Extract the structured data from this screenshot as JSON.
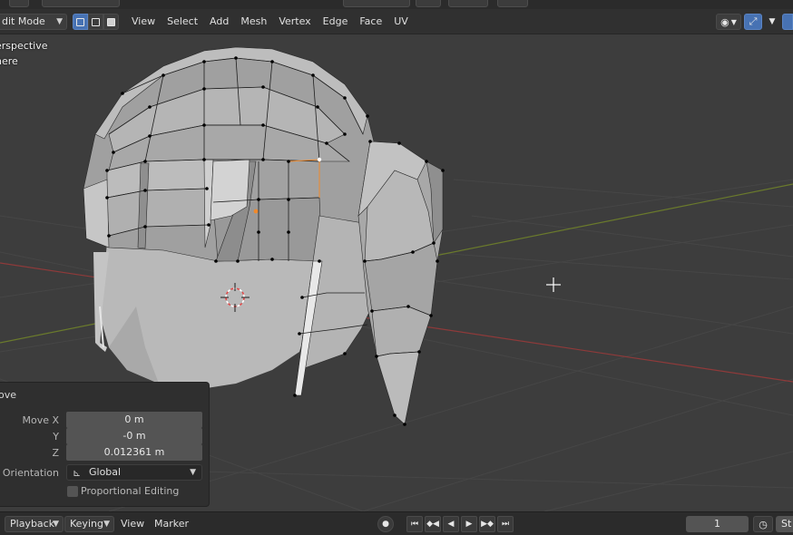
{
  "header": {
    "mode": "Edit Mode",
    "mode_visible": "dit Mode",
    "menus": [
      "View",
      "Select",
      "Add",
      "Mesh",
      "Vertex",
      "Edge",
      "Face",
      "UV"
    ],
    "transform_orientation": "Global"
  },
  "viewport": {
    "view_name": "erspective",
    "object_name": "here"
  },
  "operator_panel": {
    "title": "ove",
    "move_x_label": "Move X",
    "move_x_value": "0 m",
    "y_label": "Y",
    "y_value": "-0 m",
    "z_label": "Z",
    "z_value": "0.012361 m",
    "orientation_label": "Orientation",
    "orientation_value": "Global",
    "proportional_label": "Proportional Editing"
  },
  "timeline": {
    "playback_label": "Playback",
    "keying_label": "Keying",
    "view_label": "View",
    "marker_label": "Marker",
    "current_frame": "1",
    "start_label": "St"
  },
  "icons": {
    "cursor": "3d-cursor-icon",
    "pivot": "origin-icon"
  },
  "colors": {
    "accent": "#4772b3",
    "x_axis": "#8e3a3a",
    "y_axis": "#6a7a2c",
    "selection": "#f08a2c"
  }
}
